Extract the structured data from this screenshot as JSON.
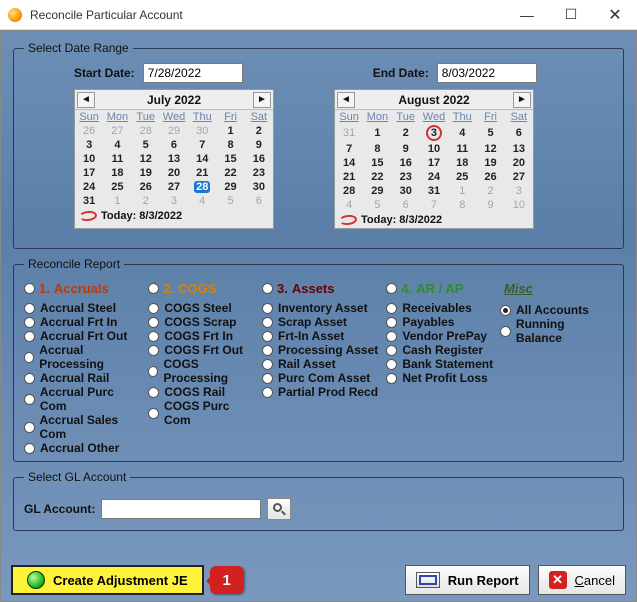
{
  "window": {
    "title": "Reconcile Particular Account"
  },
  "dateRange": {
    "legend": "Select Date Range",
    "startLabel": "Start Date:",
    "endLabel": "End Date:",
    "startValue": "7/28/2022",
    "endValue": "8/03/2022",
    "todayLabel": "Today: 8/3/2022",
    "cal1": {
      "month": "July 2022"
    },
    "cal2": {
      "month": "August 2022"
    }
  },
  "report": {
    "legend": "Reconcile Report",
    "groups": {
      "g1": {
        "num": "1.",
        "label": "Accruals"
      },
      "g2": {
        "num": "2.",
        "label": "COGS"
      },
      "g3": {
        "num": "3.",
        "label": "Assets"
      },
      "g4": {
        "num": "4.",
        "label": "AR / AP"
      },
      "misc": "Misc"
    },
    "col1": [
      "Accrual Steel",
      "Accrual Frt In",
      "Accrual Frt Out",
      "Accrual Processing",
      "Accrual Rail",
      "Accrual Purc Com",
      "Accrual Sales Com",
      "Accrual Other"
    ],
    "col2": [
      "COGS Steel",
      "COGS Scrap",
      "COGS Frt In",
      "COGS Frt Out",
      "COGS Processing",
      "COGS Rail",
      "COGS Purc Com"
    ],
    "col3": [
      "Inventory Asset",
      "Scrap Asset",
      "Frt-In Asset",
      "Processing Asset",
      "Rail Asset",
      "Purc Com Asset",
      "Partial Prod Recd"
    ],
    "col4": [
      "Receivables",
      "Payables",
      "Vendor PrePay",
      "Cash Register",
      "Bank Statement",
      "Net Profit Loss"
    ],
    "col5": [
      "All Accounts",
      "Running Balance"
    ]
  },
  "gl": {
    "legend": "Select GL Account",
    "label": "GL Account:",
    "value": ""
  },
  "buttons": {
    "create": "Create Adjustment JE",
    "callout": "1",
    "run": "Run Report",
    "cancel": "Cancel"
  },
  "chart_data": {
    "type": "table",
    "calendars": [
      {
        "month": "July 2022",
        "headers": [
          "Sun",
          "Mon",
          "Tue",
          "Wed",
          "Thu",
          "Fri",
          "Sat"
        ],
        "rows": [
          [
            {
              "d": 26,
              "dim": true
            },
            {
              "d": 27,
              "dim": true
            },
            {
              "d": 28,
              "dim": true
            },
            {
              "d": 29,
              "dim": true
            },
            {
              "d": 30,
              "dim": true
            },
            {
              "d": 1
            },
            {
              "d": 2
            }
          ],
          [
            {
              "d": 3
            },
            {
              "d": 4
            },
            {
              "d": 5
            },
            {
              "d": 6
            },
            {
              "d": 7
            },
            {
              "d": 8
            },
            {
              "d": 9
            }
          ],
          [
            {
              "d": 10
            },
            {
              "d": 11
            },
            {
              "d": 12
            },
            {
              "d": 13
            },
            {
              "d": 14
            },
            {
              "d": 15
            },
            {
              "d": 16
            }
          ],
          [
            {
              "d": 17
            },
            {
              "d": 18
            },
            {
              "d": 19
            },
            {
              "d": 20
            },
            {
              "d": 21
            },
            {
              "d": 22
            },
            {
              "d": 23
            }
          ],
          [
            {
              "d": 24
            },
            {
              "d": 25
            },
            {
              "d": 26
            },
            {
              "d": 27
            },
            {
              "d": 28,
              "selected": true
            },
            {
              "d": 29
            },
            {
              "d": 30
            }
          ],
          [
            {
              "d": 31
            },
            {
              "d": 1,
              "dim": true
            },
            {
              "d": 2,
              "dim": true
            },
            {
              "d": 3,
              "dim": true
            },
            {
              "d": 4,
              "dim": true
            },
            {
              "d": 5,
              "dim": true
            },
            {
              "d": 6,
              "dim": true
            }
          ]
        ]
      },
      {
        "month": "August 2022",
        "headers": [
          "Sun",
          "Mon",
          "Tue",
          "Wed",
          "Thu",
          "Fri",
          "Sat"
        ],
        "rows": [
          [
            {
              "d": 31,
              "dim": true
            },
            {
              "d": 1
            },
            {
              "d": 2
            },
            {
              "d": 3,
              "ringed": true
            },
            {
              "d": 4
            },
            {
              "d": 5
            },
            {
              "d": 6
            }
          ],
          [
            {
              "d": 7
            },
            {
              "d": 8
            },
            {
              "d": 9
            },
            {
              "d": 10
            },
            {
              "d": 11
            },
            {
              "d": 12
            },
            {
              "d": 13
            }
          ],
          [
            {
              "d": 14
            },
            {
              "d": 15
            },
            {
              "d": 16
            },
            {
              "d": 17
            },
            {
              "d": 18
            },
            {
              "d": 19
            },
            {
              "d": 20
            }
          ],
          [
            {
              "d": 21
            },
            {
              "d": 22
            },
            {
              "d": 23
            },
            {
              "d": 24
            },
            {
              "d": 25
            },
            {
              "d": 26
            },
            {
              "d": 27
            }
          ],
          [
            {
              "d": 28
            },
            {
              "d": 29
            },
            {
              "d": 30
            },
            {
              "d": 31
            },
            {
              "d": 1,
              "dim": true
            },
            {
              "d": 2,
              "dim": true
            },
            {
              "d": 3,
              "dim": true
            }
          ],
          [
            {
              "d": 4,
              "dim": true
            },
            {
              "d": 5,
              "dim": true
            },
            {
              "d": 6,
              "dim": true
            },
            {
              "d": 7,
              "dim": true
            },
            {
              "d": 8,
              "dim": true
            },
            {
              "d": 9,
              "dim": true
            },
            {
              "d": 10,
              "dim": true
            }
          ]
        ]
      }
    ]
  }
}
